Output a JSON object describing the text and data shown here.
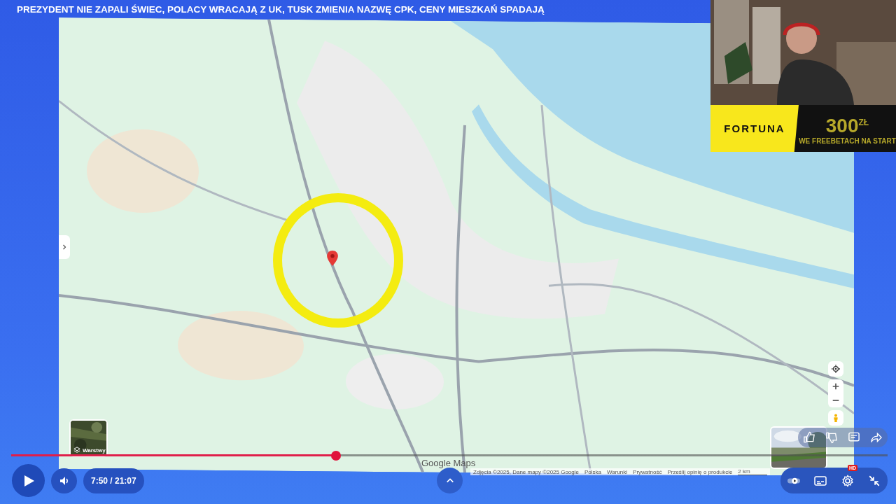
{
  "headline": "PREZYDENT NIE ZAPALI ŚWIEC, POLACY WRACAJĄ Z UK, TUSK ZMIENIA NAZWĘ CPK, CENY MIESZKAŃ SPADAJĄ",
  "map": {
    "layers_button": "Warstwy",
    "logo": "Google Maps",
    "footer": [
      "Zdjęcia ©2025, Dane mapy ©2025 Google",
      "Polska",
      "Warunki",
      "Prywatność",
      "Prześlij opinię o produkcie"
    ],
    "scale": "2 km"
  },
  "sponsor": {
    "brand": "FORTUNA",
    "amount": "300$^{ZŁ}$",
    "tagline": "WE FREEBETACH NA START"
  },
  "player": {
    "progress": {
      "level": 0.371
    },
    "playing": false,
    "time": "7:50 / 21:07",
    "quality_badge": "HD"
  }
}
